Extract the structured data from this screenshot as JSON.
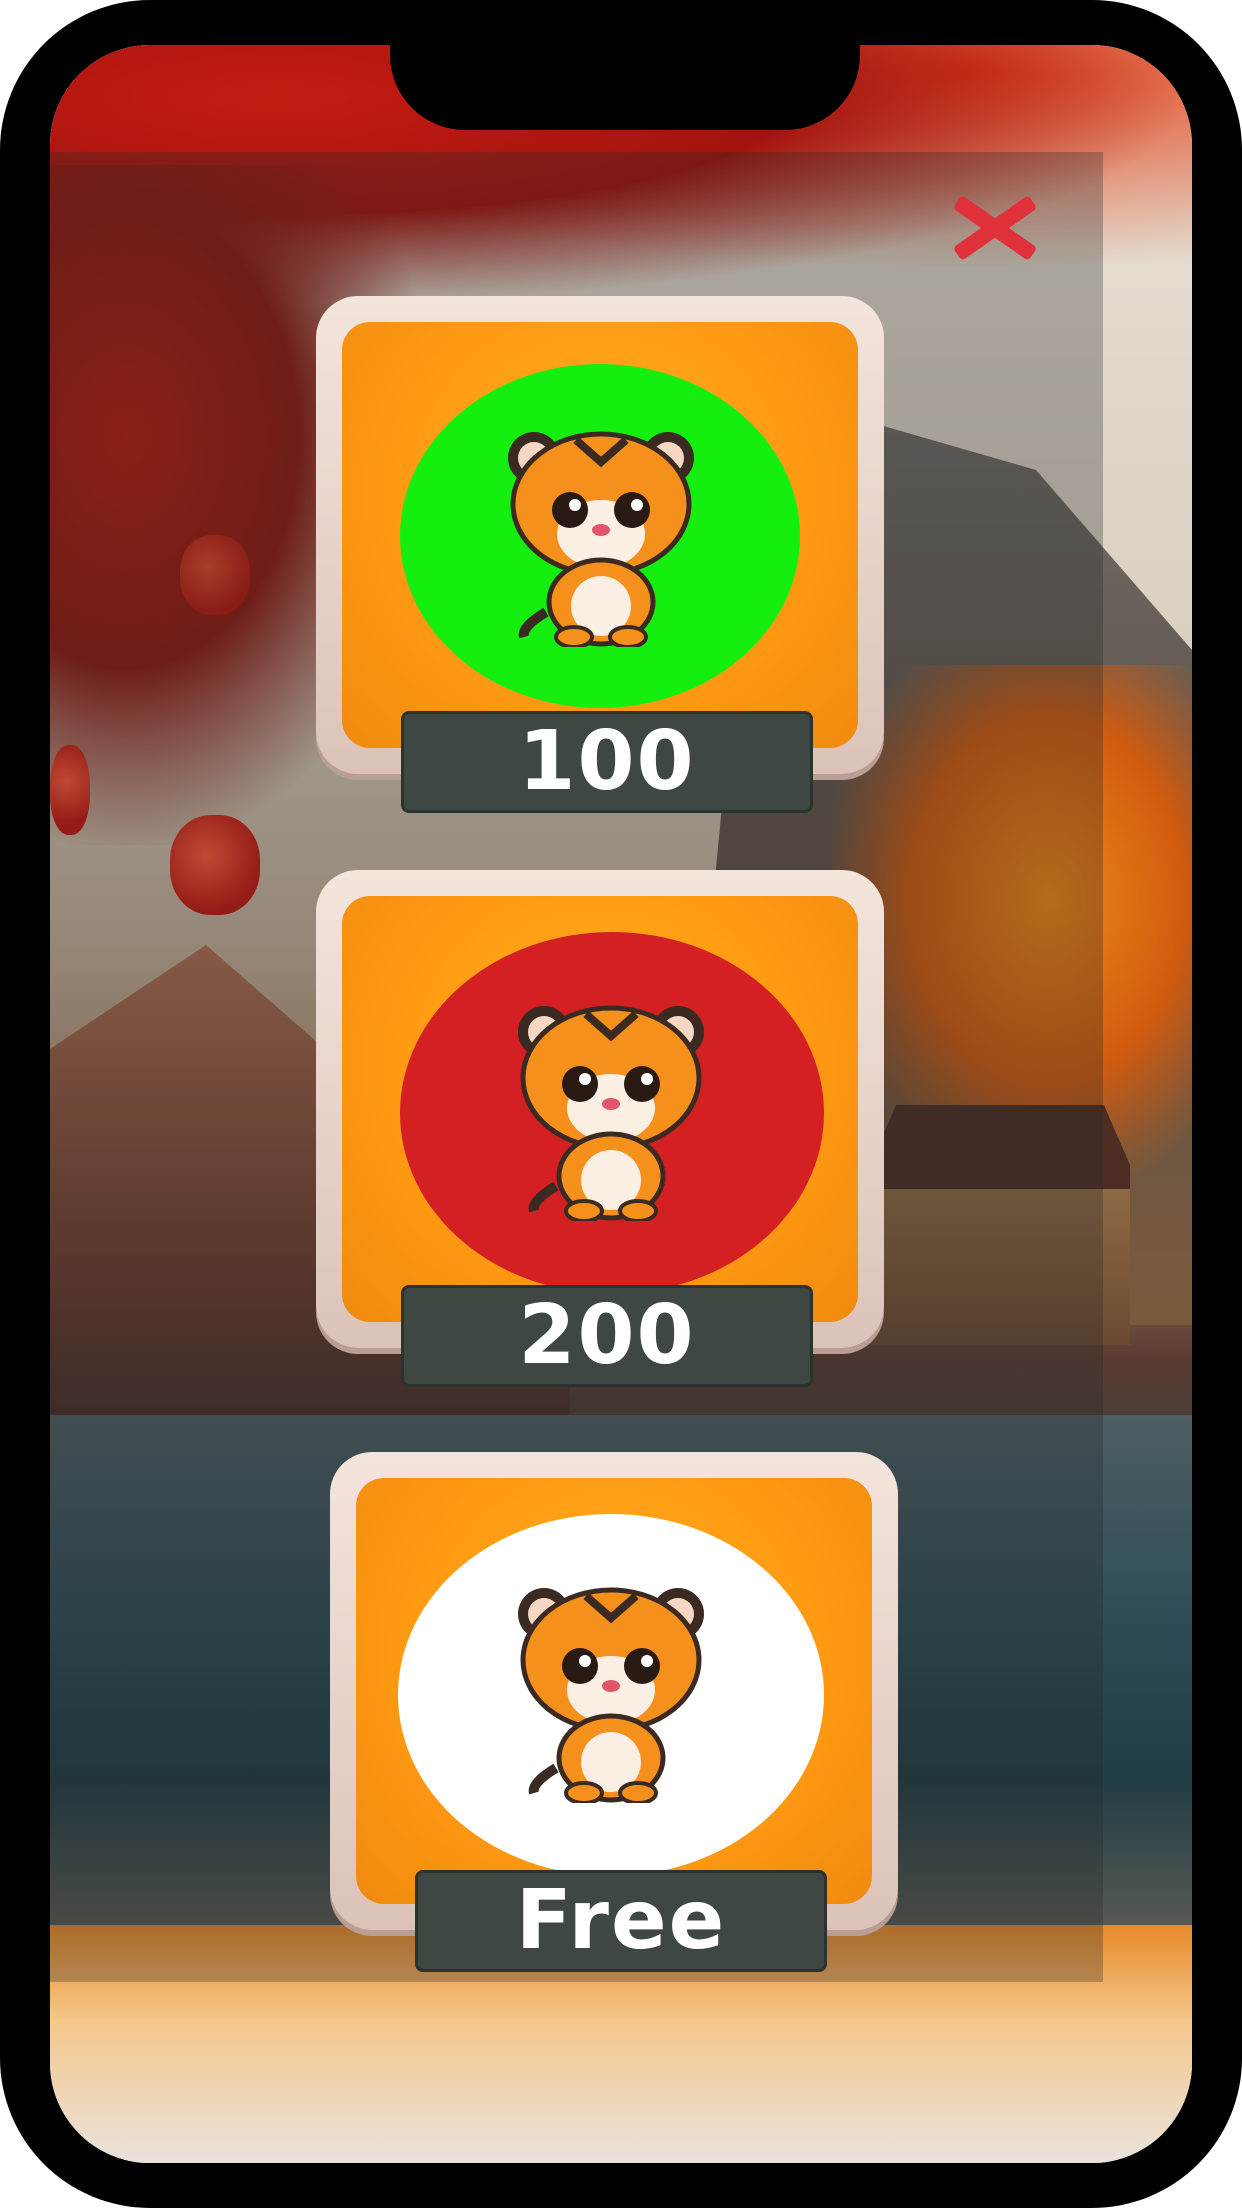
{
  "screen": "character-shop",
  "colors": {
    "frame": "#000000",
    "card_orange": "#ff9a12",
    "price_bg": "#3f4742",
    "close": "#e0303a"
  },
  "close_icon": "close-icon",
  "items": [
    {
      "price": "100",
      "circle_color": "#14ef0f",
      "character": "tiger-icon"
    },
    {
      "price": "200",
      "circle_color": "#d42022",
      "character": "tiger-icon"
    },
    {
      "price": "Free",
      "circle_color": "#ffffff",
      "character": "tiger-icon"
    }
  ]
}
